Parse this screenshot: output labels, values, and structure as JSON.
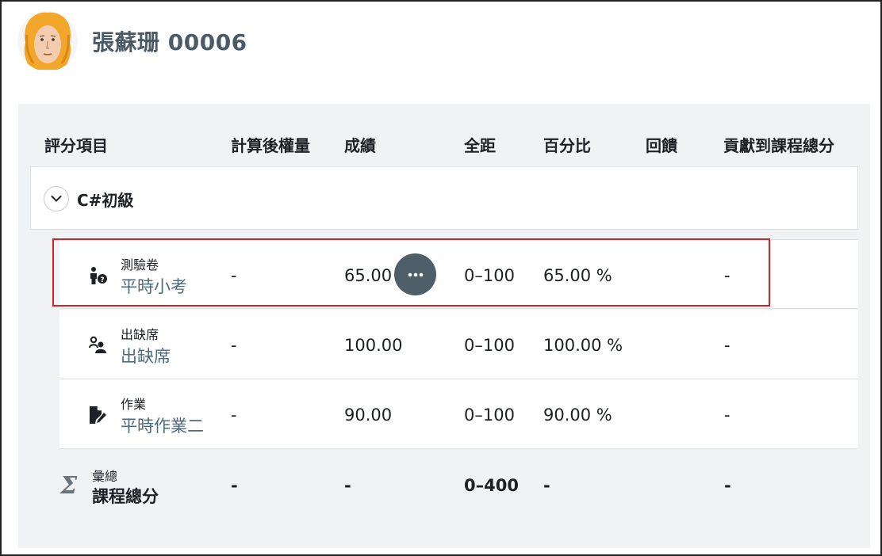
{
  "user": {
    "name": "張蘇珊 00006"
  },
  "table": {
    "headers": {
      "item": "評分項目",
      "weight": "計算後權量",
      "grade": "成績",
      "range": "全距",
      "percent": "百分比",
      "feedback": "回饋",
      "contribution": "貢獻到課程總分"
    },
    "category": {
      "name": "C#初級",
      "toggle_icon": "chevron-down-icon"
    },
    "rows": [
      {
        "type": "測驗卷",
        "name": "平時小考",
        "icon": "quiz-icon",
        "weight": "-",
        "grade": "65.00",
        "range": "0–100",
        "percent": "65.00 %",
        "feedback": "",
        "contribution": "-"
      },
      {
        "type": "出缺席",
        "name": "出缺席",
        "icon": "attendance-icon",
        "weight": "-",
        "grade": "100.00",
        "range": "0–100",
        "percent": "100.00 %",
        "feedback": "",
        "contribution": "-"
      },
      {
        "type": "作業",
        "name": "平時作業二",
        "icon": "assignment-icon",
        "weight": "-",
        "grade": "90.00",
        "range": "0–100",
        "percent": "90.00 %",
        "feedback": "",
        "contribution": "-"
      }
    ],
    "aggregate": {
      "type": "彙總",
      "name": "課程總分",
      "weight": "-",
      "grade": "-",
      "range": "0–400",
      "percent": "-",
      "contribution": "-"
    }
  },
  "colors": {
    "highlight": "#d62222",
    "link": "#4d6a80",
    "panel": "#f1f2f4"
  }
}
